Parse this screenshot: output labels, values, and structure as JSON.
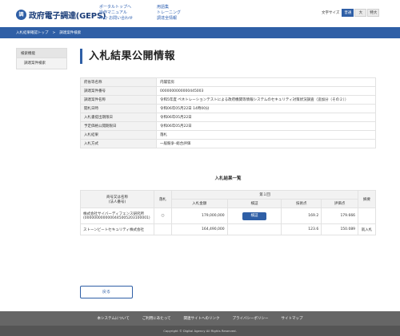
{
  "header": {
    "logo_mark": "調",
    "logo_text": "政府電子調達(GEPS)",
    "links_col1": [
      "ポータルトップへ",
      "操作マニュアル",
      "FAQ･お問い合わせ"
    ],
    "links_col2": [
      "用語集",
      "トレーニング",
      "調達全情報"
    ],
    "font_size": {
      "label": "文字サイズ",
      "options": [
        "普通",
        "大",
        "特大"
      ],
      "selected": "普通"
    }
  },
  "breadcrumb": [
    "入札結果確認トップ",
    "調達案件検索"
  ],
  "sidebar": {
    "heading": "検索機能",
    "items": [
      "調達案件検索"
    ]
  },
  "page_title": "入札結果公開情報",
  "info_rows": [
    {
      "label": "府省等名称",
      "value": "内閣官房"
    },
    {
      "label": "調達案件番号",
      "value": "0000000000000445003"
    },
    {
      "label": "調達案件名称",
      "value": "令和5年度 ペネトレーションテストによる政府機関等情報システムのセキュリティ対策状況調査（追加分（その２））"
    },
    {
      "label": "開札日時",
      "value": "令和06年05月22日 14時00分"
    },
    {
      "label": "入札書提出期限日",
      "value": "令和06年05月22日"
    },
    {
      "label": "予定価格公開期限日",
      "value": "令和06年05月22日"
    },
    {
      "label": "入札結果",
      "value": "落札"
    },
    {
      "label": "入札方式",
      "value": "一般競争･総合評価"
    }
  ],
  "results": {
    "heading": "入札結果一覧",
    "col_company": "商号又は名称\n(法人番号)",
    "col_award": "落札",
    "round_label": "第１回",
    "col_amount": "入札金額",
    "col_inspect": "検証",
    "col_tech": "技術点",
    "col_score": "評価点",
    "col_note": "摘要",
    "rows": [
      {
        "company": "株式会社サイバーディフェンス研究所",
        "corp_no": "(0000000000000445005203100001)",
        "award": "○",
        "amount": "179,000,000",
        "inspect": "検証",
        "tech": "169.2",
        "score": "179.666",
        "note": ""
      },
      {
        "company": "ストーンビートセキュリティ株式会社",
        "corp_no": "",
        "award": "",
        "amount": "164,490,000",
        "inspect": "",
        "tech": "123.6",
        "score": "150.089",
        "note": "就入札"
      }
    ]
  },
  "back_label": "戻る",
  "footer": {
    "links": [
      "本システムについて",
      "ご利用にあたって",
      "関連サイトへのリンク",
      "プライバシーポリシー",
      "サイトマップ"
    ],
    "copyright": "Copyright © Digital Agency All Rights Reserved."
  },
  "colors": {
    "brand": "#2f5fa6",
    "footer": "#666666"
  }
}
